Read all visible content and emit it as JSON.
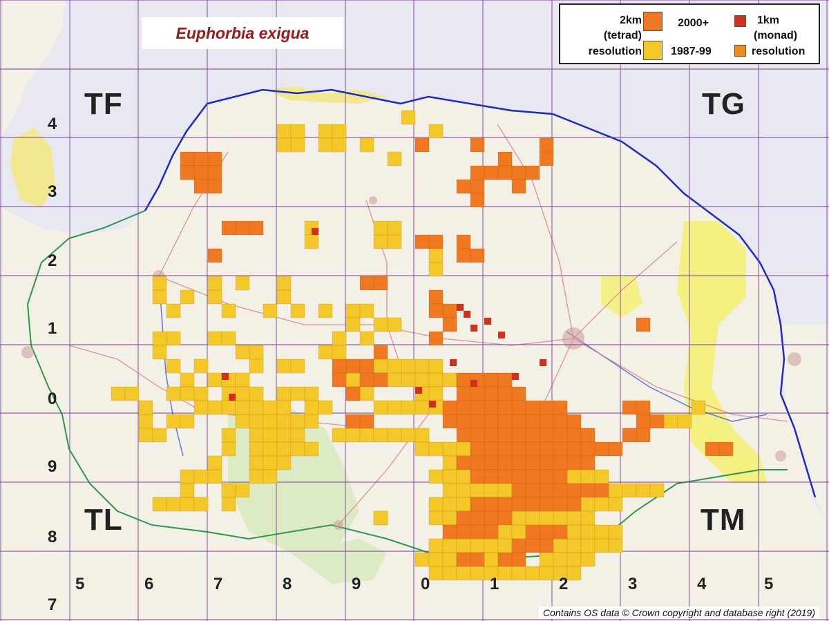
{
  "title": "Euphorbia exigua",
  "legend": {
    "tetrad_label": [
      "2km",
      "(tetrad)",
      "resolution"
    ],
    "monad_label": [
      "1km",
      "(monad)",
      "resolution"
    ],
    "period_recent": "2000+",
    "period_old": "1987-99",
    "colors": {
      "recent": "#f07820",
      "old": "#f5c82a",
      "monad_recent": "#d2301c",
      "monad_old": "#f08a1e"
    }
  },
  "grid_squares": [
    "TF",
    "TG",
    "TL",
    "TM"
  ],
  "northings": [
    "4",
    "3",
    "2",
    "1",
    "0",
    "9",
    "8",
    "7"
  ],
  "eastings": [
    "5",
    "6",
    "7",
    "8",
    "9",
    "0",
    "1",
    "2",
    "3",
    "4",
    "5"
  ],
  "credit": "Contains OS data © Crown copyright and database right (2019)",
  "map_colors": {
    "sea": "#e8e8f0",
    "land": "#f3f0e6",
    "coast": "#1a2ad0",
    "grid_line": "#7a3aa0",
    "forest": "#d8e8c0",
    "broads": "#f4f050"
  }
}
